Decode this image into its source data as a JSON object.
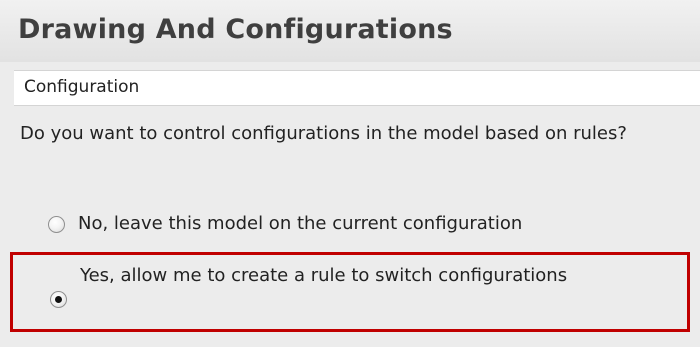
{
  "panel": {
    "title": "Drawing And Configurations"
  },
  "section": {
    "label": "Configuration"
  },
  "question": "Do you want to control configurations in the model based on rules?",
  "options": [
    {
      "label": "No, leave this model on the current configuration",
      "selected": false
    },
    {
      "label": "Yes, allow me to create a rule to switch configurations",
      "selected": true
    }
  ],
  "colors": {
    "highlight_border": "#c00000",
    "title_text": "#3f3f3f",
    "background": "#ececec"
  }
}
